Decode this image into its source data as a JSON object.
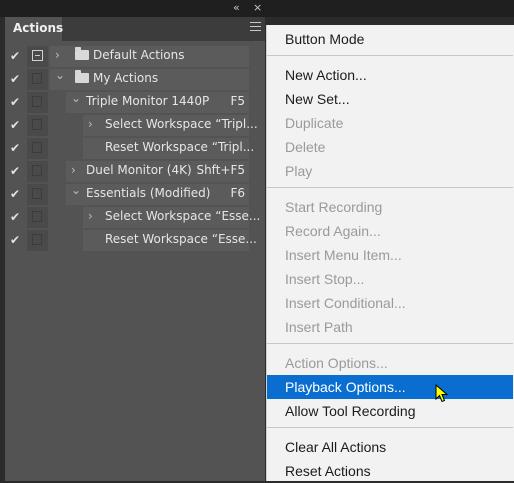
{
  "window": {
    "collapse_icon": "«",
    "close_icon": "×"
  },
  "panel": {
    "tab_label": "Actions",
    "rows": [
      {
        "checked": true,
        "dialog_icon": true,
        "expand": "›",
        "folder": true,
        "label": "Default Actions",
        "key": ""
      },
      {
        "checked": true,
        "dialog_icon": false,
        "expand": "⌄",
        "folder": true,
        "label": "My Actions",
        "key": ""
      },
      {
        "checked": true,
        "dialog_icon": false,
        "expand": "⌄",
        "folder": false,
        "label": "Triple Monitor 1440P",
        "key": "F5"
      },
      {
        "checked": true,
        "dialog_icon": false,
        "expand": "›",
        "folder": false,
        "label": "Select Workspace “Tripl...",
        "key": ""
      },
      {
        "checked": true,
        "dialog_icon": false,
        "expand": "",
        "folder": false,
        "label": "Reset Workspace “Tripl...",
        "key": ""
      },
      {
        "checked": true,
        "dialog_icon": false,
        "expand": "›",
        "folder": false,
        "label": "Duel Monitor (4K)",
        "key": "Shft+F5"
      },
      {
        "checked": true,
        "dialog_icon": false,
        "expand": "⌄",
        "folder": false,
        "label": "Essentials (Modified)",
        "key": "F6"
      },
      {
        "checked": true,
        "dialog_icon": false,
        "expand": "›",
        "folder": false,
        "label": "Select Workspace “Esse...",
        "key": ""
      },
      {
        "checked": true,
        "dialog_icon": false,
        "expand": "",
        "folder": false,
        "label": "Reset Workspace “Esse...",
        "key": ""
      }
    ]
  },
  "menu": {
    "items": [
      {
        "label": "Button Mode",
        "enabled": true
      },
      {
        "label": "New Action...",
        "enabled": true
      },
      {
        "label": "New Set...",
        "enabled": true
      },
      {
        "label": "Duplicate",
        "enabled": false
      },
      {
        "label": "Delete",
        "enabled": false
      },
      {
        "label": "Play",
        "enabled": false
      },
      {
        "label": "Start Recording",
        "enabled": false
      },
      {
        "label": "Record Again...",
        "enabled": false
      },
      {
        "label": "Insert Menu Item...",
        "enabled": false
      },
      {
        "label": "Insert Stop...",
        "enabled": false
      },
      {
        "label": "Insert Conditional...",
        "enabled": false
      },
      {
        "label": "Insert Path",
        "enabled": false
      },
      {
        "label": "Action Options...",
        "enabled": false
      },
      {
        "label": "Playback Options...",
        "enabled": true,
        "highlighted": true
      },
      {
        "label": "Allow Tool Recording",
        "enabled": true
      },
      {
        "label": "Clear All Actions",
        "enabled": true
      },
      {
        "label": "Reset Actions",
        "enabled": true
      }
    ]
  },
  "colors": {
    "highlight": "#0a6ed1",
    "panel_bg": "#535353",
    "menu_bg": "#f2f2f2"
  }
}
